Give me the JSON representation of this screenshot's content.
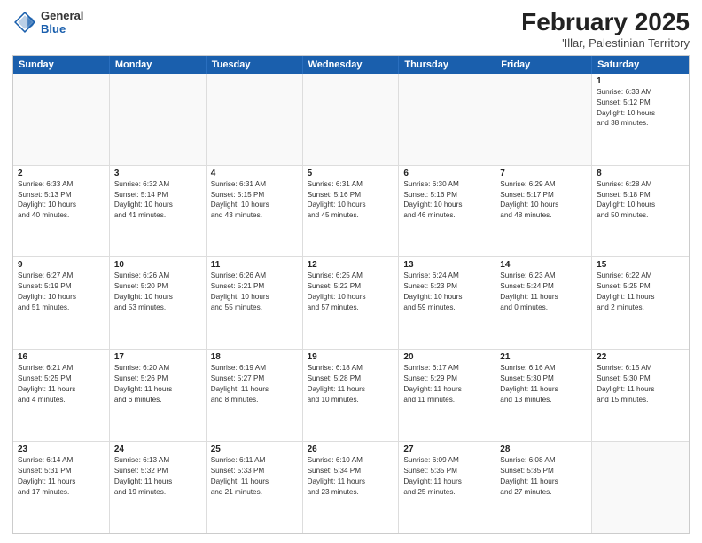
{
  "logo": {
    "general": "General",
    "blue": "Blue"
  },
  "title": "February 2025",
  "subtitle": "'Illar, Palestinian Territory",
  "days": [
    "Sunday",
    "Monday",
    "Tuesday",
    "Wednesday",
    "Thursday",
    "Friday",
    "Saturday"
  ],
  "weeks": [
    [
      {
        "day": "",
        "info": ""
      },
      {
        "day": "",
        "info": ""
      },
      {
        "day": "",
        "info": ""
      },
      {
        "day": "",
        "info": ""
      },
      {
        "day": "",
        "info": ""
      },
      {
        "day": "",
        "info": ""
      },
      {
        "day": "1",
        "info": "Sunrise: 6:33 AM\nSunset: 5:12 PM\nDaylight: 10 hours\nand 38 minutes."
      }
    ],
    [
      {
        "day": "2",
        "info": "Sunrise: 6:33 AM\nSunset: 5:13 PM\nDaylight: 10 hours\nand 40 minutes."
      },
      {
        "day": "3",
        "info": "Sunrise: 6:32 AM\nSunset: 5:14 PM\nDaylight: 10 hours\nand 41 minutes."
      },
      {
        "day": "4",
        "info": "Sunrise: 6:31 AM\nSunset: 5:15 PM\nDaylight: 10 hours\nand 43 minutes."
      },
      {
        "day": "5",
        "info": "Sunrise: 6:31 AM\nSunset: 5:16 PM\nDaylight: 10 hours\nand 45 minutes."
      },
      {
        "day": "6",
        "info": "Sunrise: 6:30 AM\nSunset: 5:16 PM\nDaylight: 10 hours\nand 46 minutes."
      },
      {
        "day": "7",
        "info": "Sunrise: 6:29 AM\nSunset: 5:17 PM\nDaylight: 10 hours\nand 48 minutes."
      },
      {
        "day": "8",
        "info": "Sunrise: 6:28 AM\nSunset: 5:18 PM\nDaylight: 10 hours\nand 50 minutes."
      }
    ],
    [
      {
        "day": "9",
        "info": "Sunrise: 6:27 AM\nSunset: 5:19 PM\nDaylight: 10 hours\nand 51 minutes."
      },
      {
        "day": "10",
        "info": "Sunrise: 6:26 AM\nSunset: 5:20 PM\nDaylight: 10 hours\nand 53 minutes."
      },
      {
        "day": "11",
        "info": "Sunrise: 6:26 AM\nSunset: 5:21 PM\nDaylight: 10 hours\nand 55 minutes."
      },
      {
        "day": "12",
        "info": "Sunrise: 6:25 AM\nSunset: 5:22 PM\nDaylight: 10 hours\nand 57 minutes."
      },
      {
        "day": "13",
        "info": "Sunrise: 6:24 AM\nSunset: 5:23 PM\nDaylight: 10 hours\nand 59 minutes."
      },
      {
        "day": "14",
        "info": "Sunrise: 6:23 AM\nSunset: 5:24 PM\nDaylight: 11 hours\nand 0 minutes."
      },
      {
        "day": "15",
        "info": "Sunrise: 6:22 AM\nSunset: 5:25 PM\nDaylight: 11 hours\nand 2 minutes."
      }
    ],
    [
      {
        "day": "16",
        "info": "Sunrise: 6:21 AM\nSunset: 5:25 PM\nDaylight: 11 hours\nand 4 minutes."
      },
      {
        "day": "17",
        "info": "Sunrise: 6:20 AM\nSunset: 5:26 PM\nDaylight: 11 hours\nand 6 minutes."
      },
      {
        "day": "18",
        "info": "Sunrise: 6:19 AM\nSunset: 5:27 PM\nDaylight: 11 hours\nand 8 minutes."
      },
      {
        "day": "19",
        "info": "Sunrise: 6:18 AM\nSunset: 5:28 PM\nDaylight: 11 hours\nand 10 minutes."
      },
      {
        "day": "20",
        "info": "Sunrise: 6:17 AM\nSunset: 5:29 PM\nDaylight: 11 hours\nand 11 minutes."
      },
      {
        "day": "21",
        "info": "Sunrise: 6:16 AM\nSunset: 5:30 PM\nDaylight: 11 hours\nand 13 minutes."
      },
      {
        "day": "22",
        "info": "Sunrise: 6:15 AM\nSunset: 5:30 PM\nDaylight: 11 hours\nand 15 minutes."
      }
    ],
    [
      {
        "day": "23",
        "info": "Sunrise: 6:14 AM\nSunset: 5:31 PM\nDaylight: 11 hours\nand 17 minutes."
      },
      {
        "day": "24",
        "info": "Sunrise: 6:13 AM\nSunset: 5:32 PM\nDaylight: 11 hours\nand 19 minutes."
      },
      {
        "day": "25",
        "info": "Sunrise: 6:11 AM\nSunset: 5:33 PM\nDaylight: 11 hours\nand 21 minutes."
      },
      {
        "day": "26",
        "info": "Sunrise: 6:10 AM\nSunset: 5:34 PM\nDaylight: 11 hours\nand 23 minutes."
      },
      {
        "day": "27",
        "info": "Sunrise: 6:09 AM\nSunset: 5:35 PM\nDaylight: 11 hours\nand 25 minutes."
      },
      {
        "day": "28",
        "info": "Sunrise: 6:08 AM\nSunset: 5:35 PM\nDaylight: 11 hours\nand 27 minutes."
      },
      {
        "day": "",
        "info": ""
      }
    ]
  ]
}
